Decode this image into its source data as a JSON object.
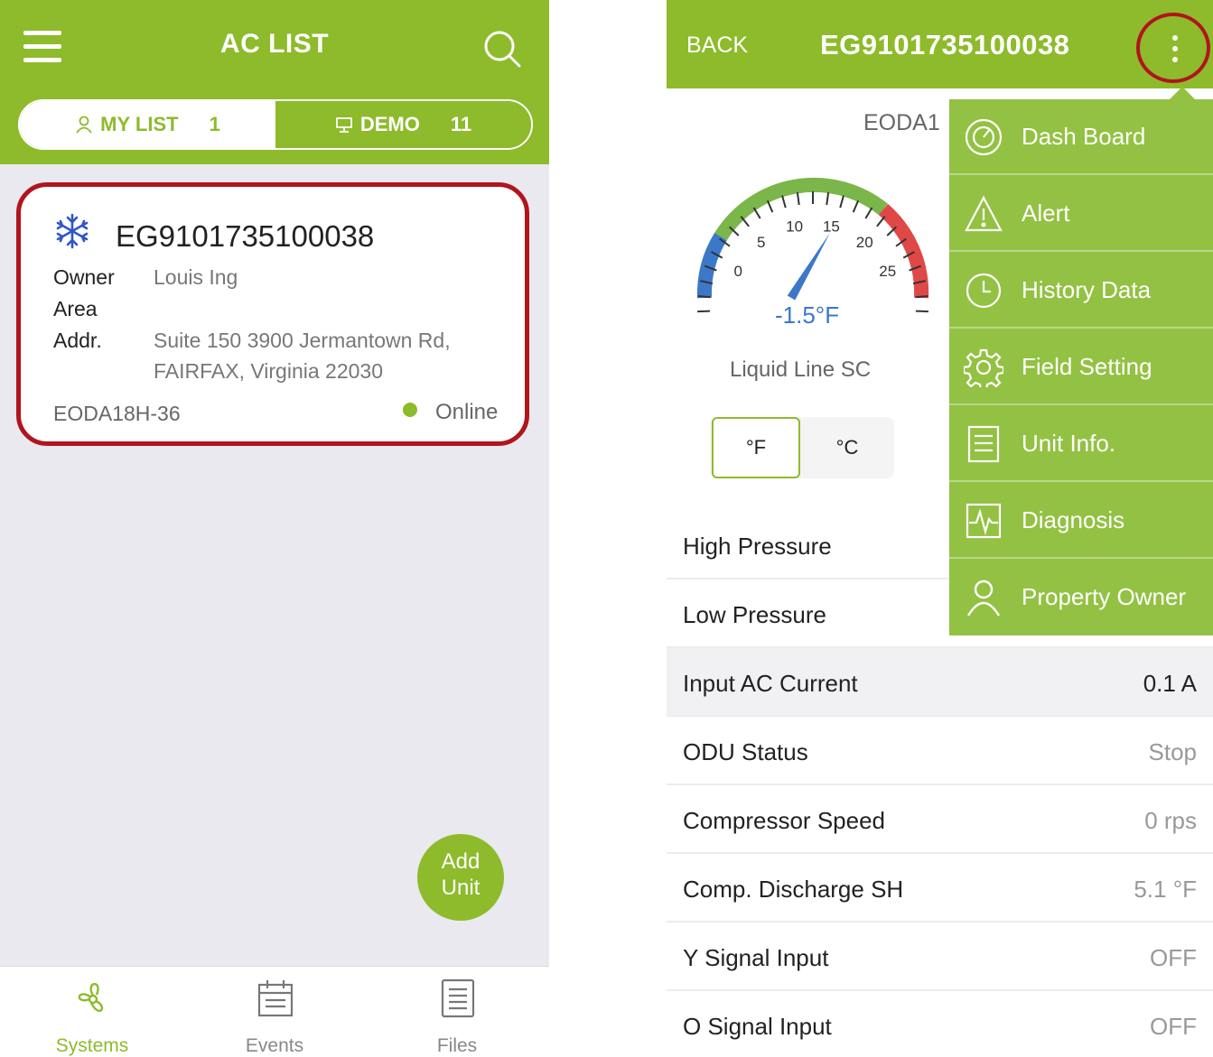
{
  "left": {
    "header": {
      "title": "AC LIST"
    },
    "segments": [
      {
        "label": "MY LIST",
        "count": "1"
      },
      {
        "label": "DEMO",
        "count": "11"
      }
    ],
    "card": {
      "id": "EG9101735100038",
      "owner_label": "Owner",
      "owner": "Louis Ing",
      "area_label": "Area",
      "addr_label": "Addr.",
      "addr_line1": "Suite 150 3900  Jermantown Rd,",
      "addr_line2": "FAIRFAX, Virginia 22030",
      "model": "EODA18H-36",
      "status": "Online"
    },
    "fab": {
      "line1": "Add",
      "line2": "Unit"
    },
    "tabs": [
      {
        "label": "Systems",
        "icon": "fan-icon"
      },
      {
        "label": "Events",
        "icon": "calendar-icon"
      },
      {
        "label": "Files",
        "icon": "file-list-icon"
      }
    ],
    "colors": {
      "accent": "#8dbb2b",
      "highlight": "#b0151e"
    }
  },
  "right": {
    "header": {
      "back": "BACK",
      "title": "EG9101735100038"
    },
    "model": "EODA1",
    "gauge": {
      "value": -1.5,
      "value_text": "-1.5°F",
      "label": "Liquid Line SC",
      "ticks": [
        "0",
        "5",
        "10",
        "15",
        "20",
        "25"
      ]
    },
    "units": {
      "f": "°F",
      "c": "°C"
    },
    "rows": [
      {
        "key": "High Pressure",
        "value": ""
      },
      {
        "key": "Low Pressure",
        "value": ""
      },
      {
        "key": "Input AC Current",
        "value": "0.1 A"
      },
      {
        "key": "ODU Status",
        "value": "Stop"
      },
      {
        "key": "Compressor Speed",
        "value": "0 rps"
      },
      {
        "key": "Comp. Discharge SH",
        "value": "5.1 °F"
      },
      {
        "key": "Y Signal Input",
        "value": "OFF"
      },
      {
        "key": "O Signal Input",
        "value": "OFF"
      }
    ],
    "menu": [
      {
        "label": "Dash Board",
        "icon": "dashboard-icon"
      },
      {
        "label": "Alert",
        "icon": "alert-icon"
      },
      {
        "label": "History Data",
        "icon": "clock-icon"
      },
      {
        "label": "Field Setting",
        "icon": "gear-icon"
      },
      {
        "label": "Unit Info.",
        "icon": "document-icon"
      },
      {
        "label": "Diagnosis",
        "icon": "pulse-icon"
      },
      {
        "label": "Property Owner",
        "icon": "person-icon"
      }
    ]
  }
}
